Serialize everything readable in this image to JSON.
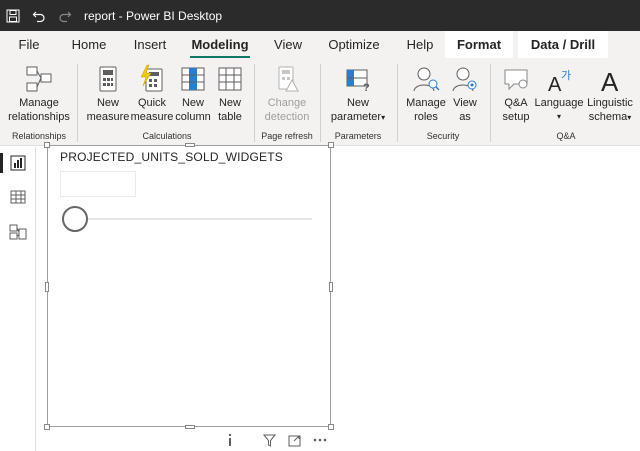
{
  "window": {
    "title": "report - Power BI Desktop"
  },
  "quick_access": [
    {
      "icon": "save-icon"
    },
    {
      "icon": "undo-icon"
    },
    {
      "icon": "redo-icon"
    }
  ],
  "tabs": [
    "File",
    "Home",
    "Insert",
    "Modeling",
    "View",
    "Optimize",
    "Help",
    "Format",
    "Data / Drill"
  ],
  "active_tab": "Modeling",
  "ribbon": {
    "manage_relationships": {
      "line1": "Manage",
      "line2": "relationships"
    },
    "new_measure": {
      "line1": "New",
      "line2": "measure"
    },
    "quick_measure": {
      "line1": "Quick",
      "line2": "measure"
    },
    "new_column": {
      "line1": "New",
      "line2": "column"
    },
    "new_table": {
      "line1": "New",
      "line2": "table"
    },
    "change_detection": {
      "line1": "Change",
      "line2": "detection"
    },
    "new_parameter": {
      "line1": "New",
      "line2": "parameter"
    },
    "manage_roles": {
      "line1": "Manage",
      "line2": "roles"
    },
    "view_as": {
      "line1": "View",
      "line2": "as"
    },
    "qa_setup": {
      "line1": "Q&A",
      "line2": "setup"
    },
    "language": {
      "line1": "Language"
    },
    "linguistic_schema": {
      "line1": "Linguistic",
      "line2": "schema"
    },
    "groups": {
      "relationships": "Relationships",
      "calculations": "Calculations",
      "page_refresh": "Page refresh",
      "parameters": "Parameters",
      "security": "Security",
      "qa": "Q&A"
    }
  },
  "visual": {
    "title": "PROJECTED_UNITS_SOLD_WIDGETS",
    "input_value": "",
    "slider_fraction": 0.0
  },
  "colors": {
    "accent": "#117865",
    "titlebar": "#2b2b2b",
    "chart_yellow": "#f2c811",
    "icon_blue": "#2b7cd3"
  }
}
